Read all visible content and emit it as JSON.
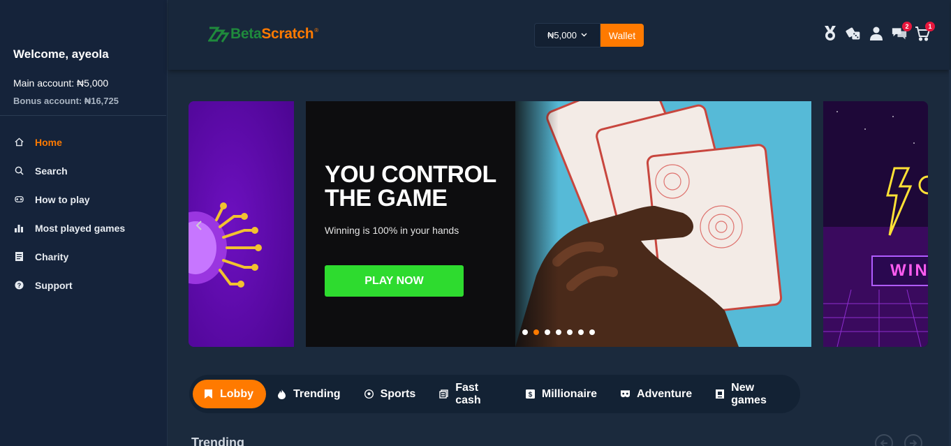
{
  "sidebar": {
    "welcome": "Welcome, ayeola",
    "main_account": "Main account: ₦5,000",
    "bonus_account": "Bonus account: ₦16,725",
    "items": [
      {
        "label": "Home",
        "icon": "home-icon",
        "active": true
      },
      {
        "label": "Search",
        "icon": "search-icon"
      },
      {
        "label": "How to play",
        "icon": "gamepad-icon"
      },
      {
        "label": "Most played games",
        "icon": "bar-chart-icon"
      },
      {
        "label": "Charity",
        "icon": "document-icon"
      },
      {
        "label": "Support",
        "icon": "help-icon"
      }
    ]
  },
  "header": {
    "logo_beta": "Beta",
    "logo_scratch": "Scratch",
    "logo_reg": "®",
    "balance": "₦5,000",
    "wallet_label": "Wallet",
    "icons": [
      {
        "name": "medal-icon"
      },
      {
        "name": "dice-icon"
      },
      {
        "name": "user-icon"
      },
      {
        "name": "chat-icon",
        "badge": "2"
      },
      {
        "name": "cart-icon",
        "badge": "1"
      }
    ]
  },
  "hero": {
    "title_line1": "YOU CONTROL",
    "title_line2": "THE GAME",
    "subtitle": "Winning is 100% in your hands",
    "button": "PLAY NOW",
    "dots_count": 7,
    "active_dot": 1,
    "right_slide_text": "WIN"
  },
  "tabs": [
    {
      "label": "Lobby",
      "icon": "bookmark-icon",
      "active": true
    },
    {
      "label": "Trending",
      "icon": "fire-icon"
    },
    {
      "label": "Sports",
      "icon": "soccer-ball-icon"
    },
    {
      "label": "Fast cash",
      "icon": "cash-icon"
    },
    {
      "label": "Millionaire",
      "icon": "dollar-icon"
    },
    {
      "label": "Adventure",
      "icon": "mask-icon"
    },
    {
      "label": "New games",
      "icon": "new-box-icon"
    }
  ],
  "section": {
    "title": "Trending"
  },
  "colors": {
    "accent": "#ff7a00",
    "cta": "#2edb2f",
    "badge": "#e8173d"
  }
}
